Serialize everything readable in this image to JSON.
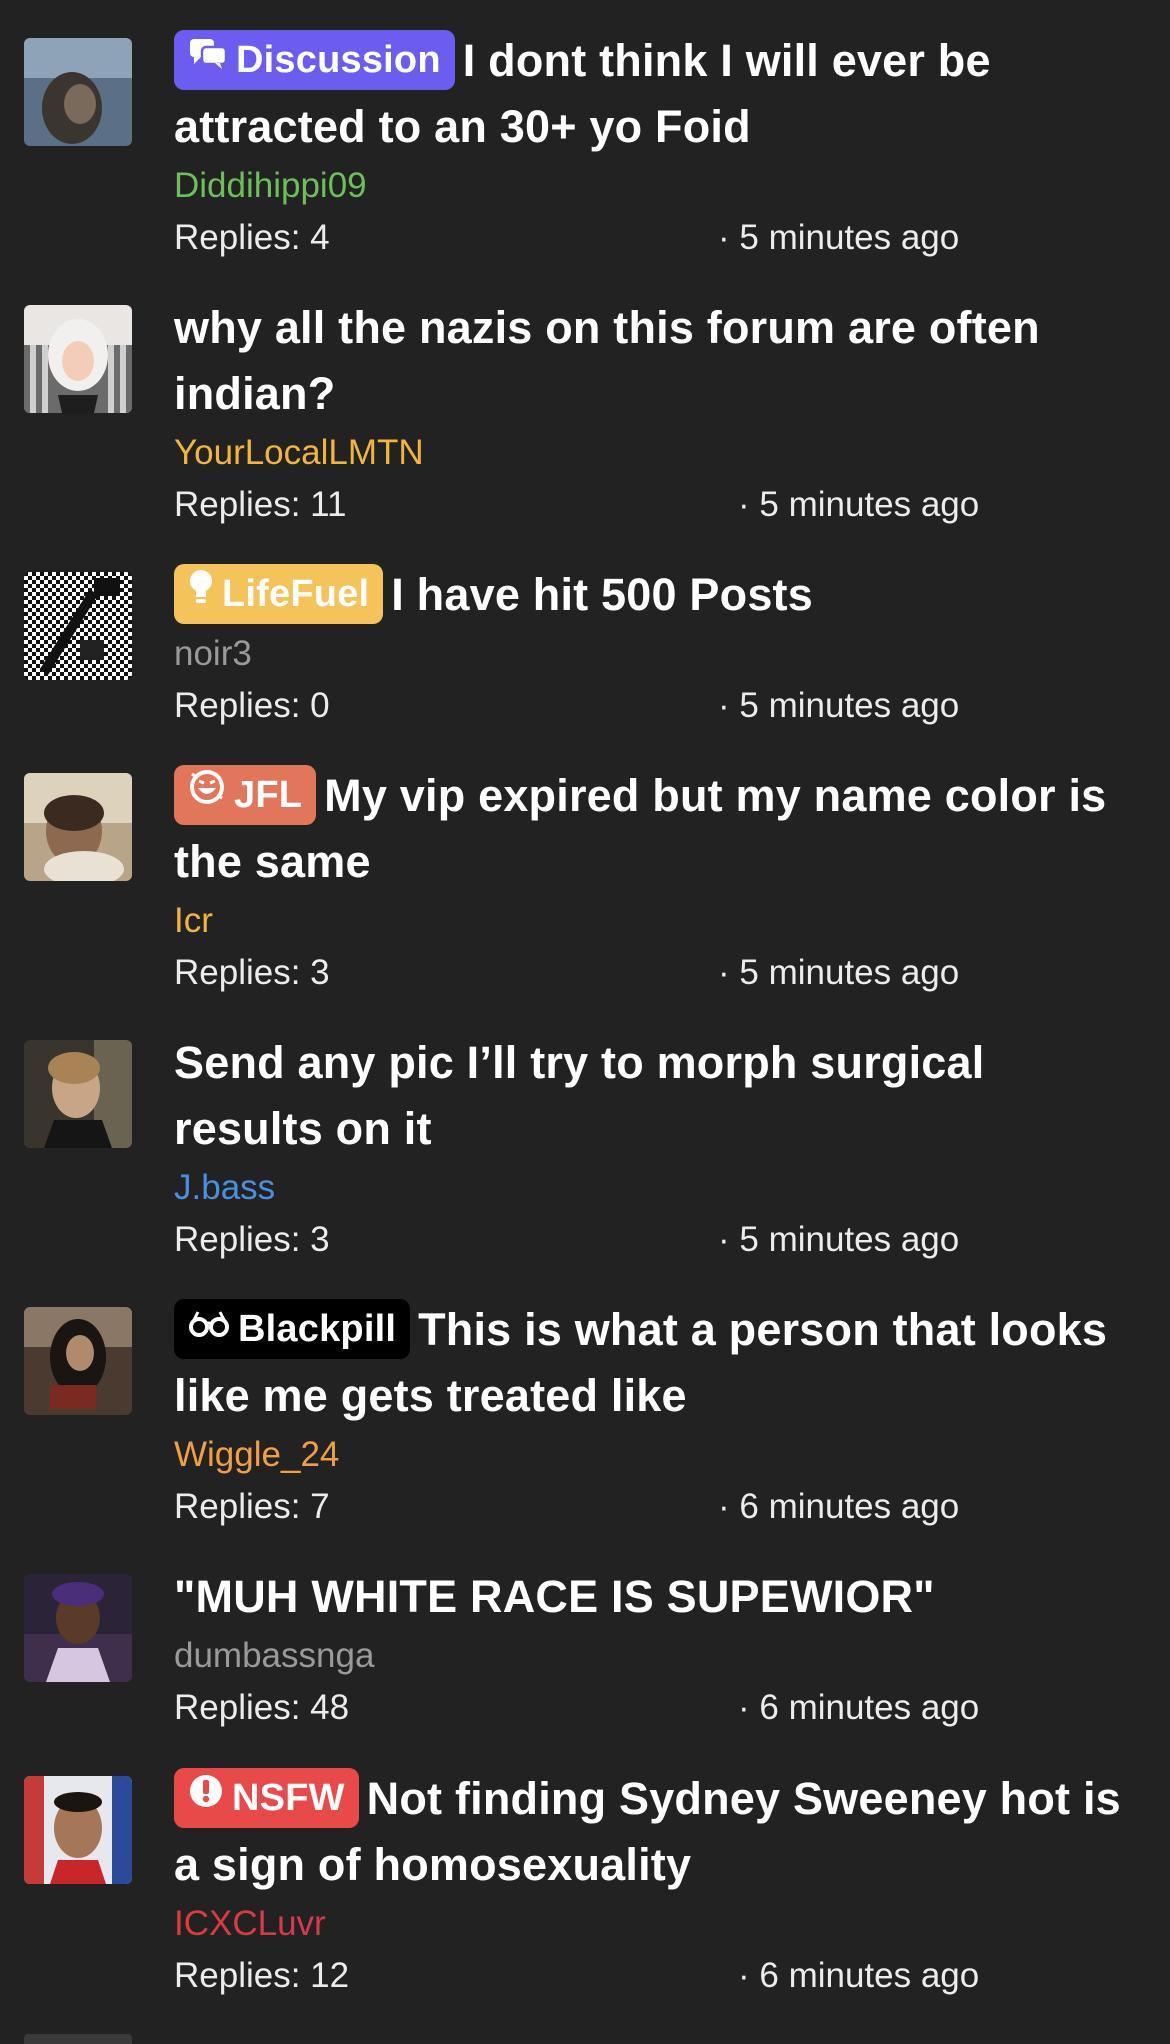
{
  "colors": {
    "background": "#222222",
    "discussion": "#6b5df0",
    "lifefuel": "#f4c35a",
    "jfl": "#e2765a",
    "blackpill": "#000000",
    "nsfw": "#e84a4a"
  },
  "threads": [
    {
      "prefix": {
        "label": "Discussion",
        "icon": "chat-bubbles-icon",
        "color": "#6b5df0"
      },
      "title": "I dont think I will ever be attracted to an 30+ yo Foid",
      "author": "Diddihippi09",
      "author_color": "#6dbf5b",
      "replies": "Replies: 4",
      "time": "· 5 minutes ago"
    },
    {
      "prefix": null,
      "title": "why all the nazis on this forum are often indian?",
      "author": "YourLocalLMTN",
      "author_color": "#f2b53a",
      "replies": "Replies: 11",
      "time": "· 5 minutes ago"
    },
    {
      "prefix": {
        "label": "LifeFuel",
        "icon": "lightbulb-icon",
        "color": "#f4c35a"
      },
      "title": "I have hit 500 Posts",
      "author": "noir3",
      "author_color": "#9a9a9a",
      "replies": "Replies: 0",
      "time": "· 5 minutes ago"
    },
    {
      "prefix": {
        "label": "JFL",
        "icon": "laugh-icon",
        "color": "#e2765a"
      },
      "title": "My vip expired but my name color is the same",
      "author": "Icr",
      "author_color": "#f2b53a",
      "replies": "Replies: 3",
      "time": "· 5 minutes ago"
    },
    {
      "prefix": null,
      "title": "Send any pic I’ll try to morph surgical results on it",
      "author": "J.bass",
      "author_color": "#4a90e2",
      "replies": "Replies: 3",
      "time": "· 5 minutes ago"
    },
    {
      "prefix": {
        "label": "Blackpill",
        "icon": "glasses-icon",
        "color": "#000000"
      },
      "title": "This is what a person that looks like me gets treated like",
      "author": "Wiggle_24",
      "author_color": "#f0a041",
      "replies": "Replies: 7",
      "time": "· 6 minutes ago"
    },
    {
      "prefix": null,
      "title": "\"MUH WHITE RACE IS SUPEWIOR\"",
      "author": "dumbassnga",
      "author_color": "#9a9a9a",
      "replies": "Replies: 48",
      "time": "· 6 minutes ago"
    },
    {
      "prefix": {
        "label": "NSFW",
        "icon": "alert-icon",
        "color": "#e84a4a"
      },
      "title": "Not finding Sydney Sweeney hot is a sign of homosexuality",
      "author": "ICXCLuvr",
      "author_color": "gradient-red-purple",
      "replies": "Replies: 12",
      "time": "· 6 minutes ago"
    }
  ]
}
